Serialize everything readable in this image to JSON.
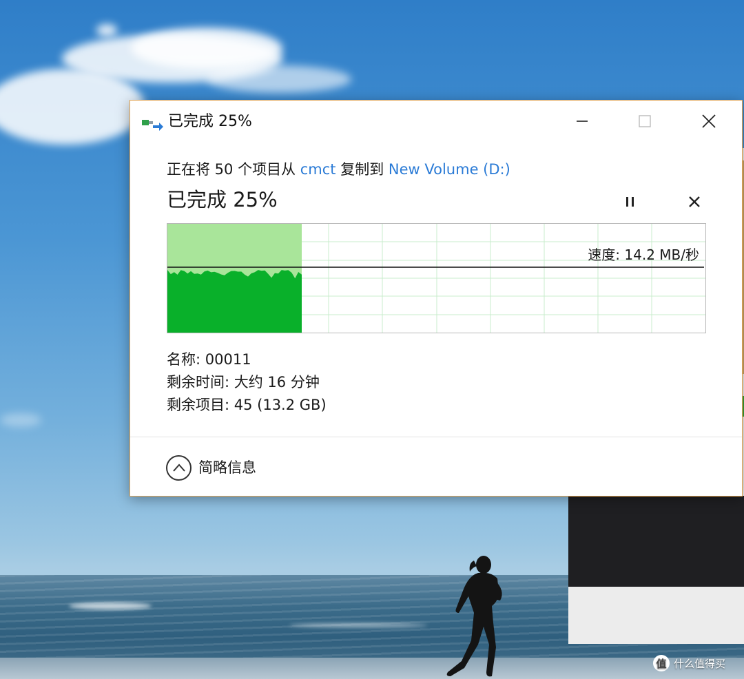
{
  "dialog": {
    "title": "已完成 25%",
    "subtitle": {
      "prefix": "正在将 50 个项目从 ",
      "source": "cmct",
      "middle": " 复制到 ",
      "destination": "New Volume (D:)"
    },
    "progress_heading": "已完成 25%",
    "progress_percent": 25,
    "speed_label": "速度: 14.2 MB/秒",
    "details": {
      "name": "名称: 00011",
      "time_remaining": "剩余时间: 大约 16 分钟",
      "items_remaining": "剩余项目: 45 (13.2 GB)"
    },
    "toggle_label": "简略信息",
    "icons": {
      "title": "file-copy-icon",
      "minimize": "minimize-icon",
      "maximize": "maximize-icon",
      "close": "close-icon",
      "pause": "pause-icon",
      "cancel": "cancel-icon",
      "toggle": "chevron-up-icon"
    },
    "colors": {
      "progress_fill": "#09b02a",
      "progress_band": "#a9e59a",
      "grid": "#c8eccc",
      "link": "#2b7bd6",
      "border": "#e0a250"
    }
  },
  "watermark": {
    "logo": "值",
    "text": "什么值得买"
  }
}
